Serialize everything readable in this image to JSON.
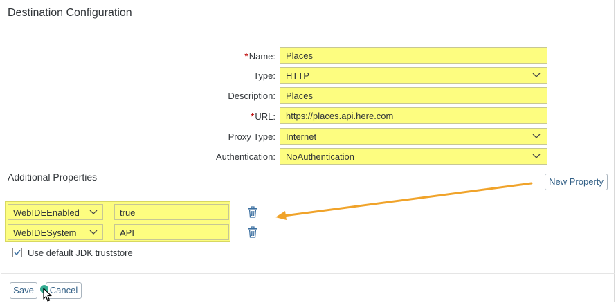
{
  "page": {
    "title": "Destination Configuration"
  },
  "form": {
    "name_label": "Name:",
    "name_value": "Places",
    "type_label": "Type:",
    "type_value": "HTTP",
    "description_label": "Description:",
    "description_value": "Places",
    "url_label": "URL:",
    "url_value": "https://places.api.here.com",
    "proxy_label": "Proxy Type:",
    "proxy_value": "Internet",
    "auth_label": "Authentication:",
    "auth_value": "NoAuthentication",
    "required_marker": "*"
  },
  "additional": {
    "title": "Additional Properties",
    "new_property_label": "New Property",
    "properties": [
      {
        "key": "WebIDEEnabled",
        "value": "true"
      },
      {
        "key": "WebIDESystem",
        "value": "API"
      }
    ],
    "jdk_label": "Use default JDK truststore",
    "jdk_checked": true
  },
  "footer": {
    "save_label": "Save",
    "cancel_label": "Cancel"
  },
  "colors": {
    "highlight": "#fdfd80",
    "annotation_arrow": "#f0a32a",
    "link_blue": "#346187",
    "required": "#bb0000"
  },
  "icons": [
    "chevron-down-icon",
    "trash-icon",
    "checkmark-icon",
    "mouse-cursor-icon"
  ]
}
